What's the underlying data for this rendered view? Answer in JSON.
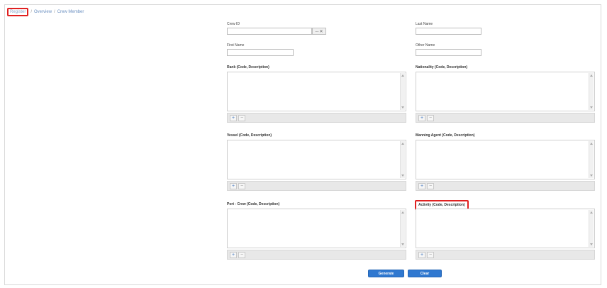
{
  "breadcrumb": [
    "Register",
    "Overview",
    "Crew Member"
  ],
  "fields": {
    "crew_id_label": "Crew ID",
    "last_name_label": "Last Name",
    "first_name_label": "First Name",
    "other_name_label": "Other Name",
    "lookup_label": "..."
  },
  "panels": {
    "rank": "Rank (Code, Description)",
    "nationality": "Nationality (Code, Description)",
    "vessel": "Vessel (Code, Description)",
    "manning_agent": "Manning Agent (Code, Description)",
    "port_crew": "Port - Crew (Code, Description)",
    "activity": "Activity (Code, Description)"
  },
  "toolbar": {
    "add": "+",
    "remove": "−"
  },
  "actions": {
    "generate": "Generate",
    "clear": "Clear"
  },
  "colors": {
    "highlight": "#e02020",
    "primary_button": "#2f78d0",
    "link": "#6a8fc0"
  }
}
